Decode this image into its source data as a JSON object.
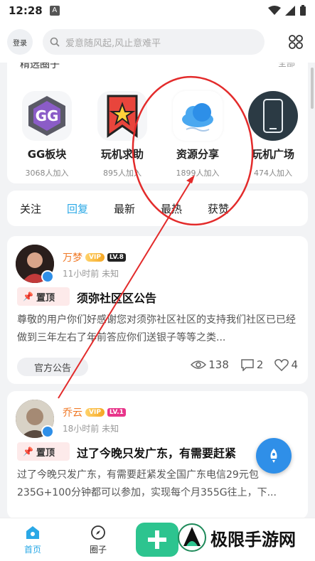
{
  "status_bar": {
    "time": "12:28",
    "app_icon_letter": "A"
  },
  "top_bar": {
    "login_label": "登录",
    "search_placeholder": "爱意随风起,风止意难平"
  },
  "circles": {
    "header_title": "精选圈子",
    "header_more": "全部",
    "items": [
      {
        "name": "GG板块",
        "count": "3068人加入"
      },
      {
        "name": "玩机求助",
        "count": "895人加入"
      },
      {
        "name": "资源分享",
        "count": "1899人加入"
      },
      {
        "name": "玩机广场",
        "count": "474人加入"
      }
    ]
  },
  "tabs": [
    {
      "label": "关注",
      "active": false
    },
    {
      "label": "回复",
      "active": true
    },
    {
      "label": "最新",
      "active": false
    },
    {
      "label": "最热",
      "active": false
    },
    {
      "label": "获赞",
      "active": false
    }
  ],
  "posts": [
    {
      "author": "万梦",
      "vip": "VIP",
      "level": "LV.8",
      "meta": "11小时前   未知",
      "pin_label": "置顶",
      "title": "须弥社区区公告",
      "body": "尊敬的用户你们好感谢您对须弥社区社区的支持我们社区已已经做到三年左右了年前答应你们送银子等等之类...",
      "tag": "官方公告",
      "views": "138",
      "comments": "2",
      "likes": "4"
    },
    {
      "author": "乔云",
      "vip": "VIP",
      "level": "LV.1",
      "meta": "18小时前   未知",
      "pin_label": "置顶",
      "title": "过了今晚只发广东，有需要赶紧",
      "body": "过了今晚只发广东，有需要赶紧发全国广东电信29元包235G+100分钟都可以参加，实现每个月355G往上，下..."
    }
  ],
  "bottom_nav": {
    "home_label": "首页",
    "circle_label": "圈子"
  },
  "watermark": "极限手游网",
  "colors": {
    "accent": "#2aa8e6",
    "add_button": "#2dc48f",
    "author_name": "#f07a28",
    "annotation_red": "#e32b2b"
  }
}
